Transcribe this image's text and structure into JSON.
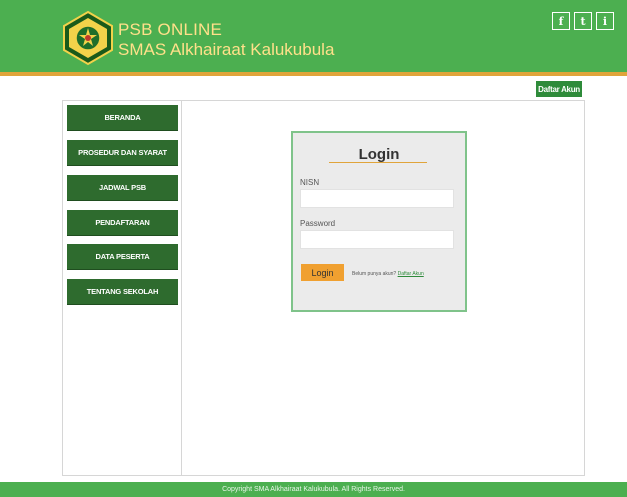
{
  "header": {
    "title_line1": "PSB ONLINE",
    "title_line2": "SMAS Alkhairaat Kalukubula",
    "social": [
      {
        "icon": "facebook-icon",
        "glyph": "f"
      },
      {
        "icon": "twitter-icon",
        "glyph": "t"
      },
      {
        "icon": "instagram-icon",
        "glyph": "i"
      }
    ],
    "register_link": "Daftar Akun"
  },
  "sidebar": {
    "items": [
      {
        "label": "BERANDA"
      },
      {
        "label": "PROSEDUR DAN SYARAT"
      },
      {
        "label": "JADWAL PSB"
      },
      {
        "label": "PENDAFTARAN"
      },
      {
        "label": "DATA PESERTA"
      },
      {
        "label": "TENTANG SEKOLAH"
      }
    ]
  },
  "login": {
    "title": "Login",
    "nisn_label": "NISN",
    "nisn_value": "",
    "password_label": "Password",
    "password_value": "",
    "button": "Login",
    "no_account_text": "Belum punya akun?",
    "register_link": "Daftar Akun"
  },
  "footer": {
    "text": "Copyright SMA Alkhairaat Kalukubula. All Rights Reserved."
  },
  "colors": {
    "header_green": "#4caf50",
    "accent_orange": "#e0a43a",
    "nav_green": "#2e6b2e",
    "button_orange": "#f0a030"
  }
}
